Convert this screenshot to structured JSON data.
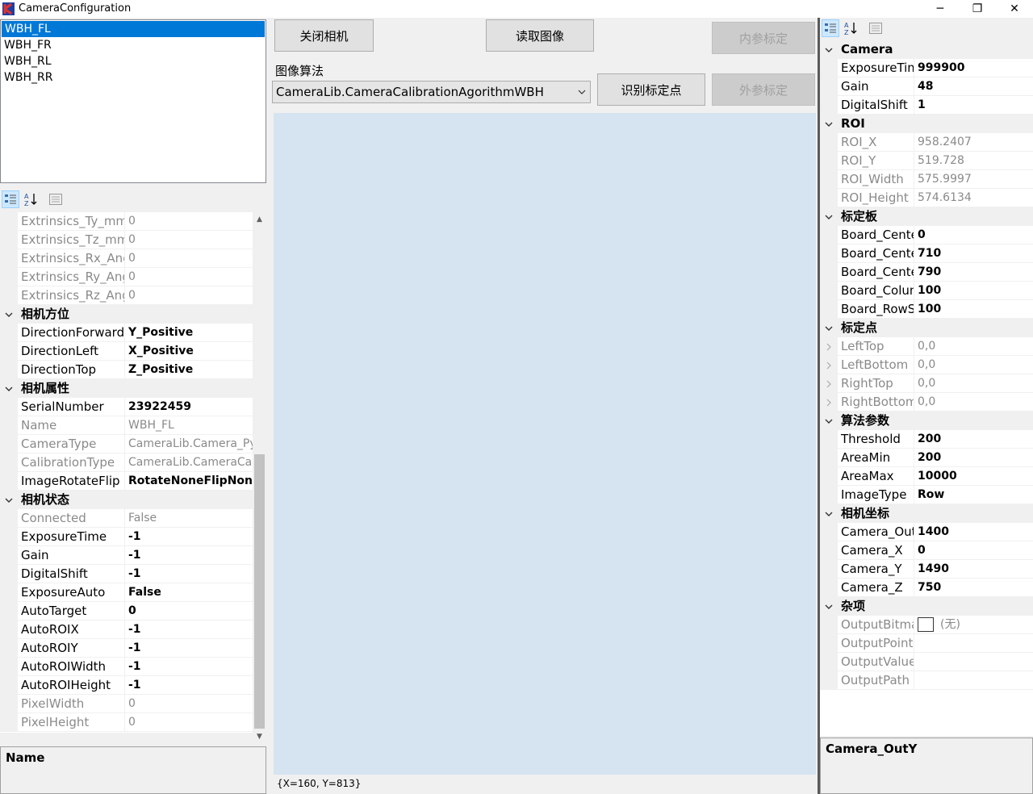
{
  "window": {
    "title": "CameraConfiguration",
    "minimize": "─",
    "restore": "❐",
    "close": "✕"
  },
  "camera_list": [
    "WBH_FL",
    "WBH_FR",
    "WBH_RL",
    "WBH_RR"
  ],
  "selected_camera": "WBH_FL",
  "buttons": {
    "close_camera": "关闭相机",
    "read_image": "读取图像",
    "intrinsic_calib": "内参标定",
    "identify_points": "识别标定点",
    "extrinsic_calib": "外参标定"
  },
  "algorithm": {
    "label": "图像算法",
    "value": "CameraLib.CameraCalibrationAgorithmWBH"
  },
  "coord_text": "{X=160, Y=813}",
  "left_grid": {
    "rows_top": [
      {
        "name": "Extrinsics_Ty_mm",
        "value": "0"
      },
      {
        "name": "Extrinsics_Tz_mm",
        "value": "0"
      },
      {
        "name": "Extrinsics_Rx_Ang",
        "value": "0"
      },
      {
        "name": "Extrinsics_Ry_Ang",
        "value": "0"
      },
      {
        "name": "Extrinsics_Rz_Ang",
        "value": "0"
      }
    ],
    "cat_direction": "相机方位",
    "direction": [
      {
        "name": "DirectionForward",
        "value": "Y_Positive"
      },
      {
        "name": "DirectionLeft",
        "value": "X_Positive"
      },
      {
        "name": "DirectionTop",
        "value": "Z_Positive"
      }
    ],
    "cat_props": "相机属性",
    "props": [
      {
        "name": "SerialNumber",
        "value": "23922459",
        "ro": false
      },
      {
        "name": "Name",
        "value": "WBH_FL",
        "ro": true
      },
      {
        "name": "CameraType",
        "value": "CameraLib.Camera_Pyl",
        "ro": true
      },
      {
        "name": "CalibrationType",
        "value": "CameraLib.CameraCali",
        "ro": true
      },
      {
        "name": "ImageRotateFlip",
        "value": "RotateNoneFlipNone",
        "ro": false
      }
    ],
    "cat_status": "相机状态",
    "status": [
      {
        "name": "Connected",
        "value": "False",
        "ro": true
      },
      {
        "name": "ExposureTime",
        "value": "-1",
        "ro": false
      },
      {
        "name": "Gain",
        "value": "-1",
        "ro": false
      },
      {
        "name": "DigitalShift",
        "value": "-1",
        "ro": false
      },
      {
        "name": "ExposureAuto",
        "value": "False",
        "ro": false
      },
      {
        "name": "AutoTarget",
        "value": "0",
        "ro": false
      },
      {
        "name": "AutoROIX",
        "value": "-1",
        "ro": false
      },
      {
        "name": "AutoROIY",
        "value": "-1",
        "ro": false
      },
      {
        "name": "AutoROIWidth",
        "value": "-1",
        "ro": false
      },
      {
        "name": "AutoROIHeight",
        "value": "-1",
        "ro": false
      },
      {
        "name": "PixelWidth",
        "value": "0",
        "ro": true
      },
      {
        "name": "PixelHeight",
        "value": "0",
        "ro": true
      }
    ],
    "description": "Name"
  },
  "right_grid": {
    "categories": [
      {
        "name": "Camera",
        "rows": [
          {
            "name": "ExposureTim",
            "value": "999900",
            "ro": false
          },
          {
            "name": "Gain",
            "value": "48",
            "ro": false
          },
          {
            "name": "DigitalShift",
            "value": "1",
            "ro": false
          }
        ]
      },
      {
        "name": "ROI",
        "rows": [
          {
            "name": "ROI_X",
            "value": "958.2407",
            "ro": true
          },
          {
            "name": "ROI_Y",
            "value": "519.728",
            "ro": true
          },
          {
            "name": "ROI_Width",
            "value": "575.9997",
            "ro": true
          },
          {
            "name": "ROI_Height",
            "value": "574.6134",
            "ro": true
          }
        ]
      },
      {
        "name": "标定板",
        "rows": [
          {
            "name": "Board_Cente",
            "value": "0",
            "ro": false
          },
          {
            "name": "Board_Cente",
            "value": "710",
            "ro": false
          },
          {
            "name": "Board_Cente",
            "value": "790",
            "ro": false
          },
          {
            "name": "Board_Colum",
            "value": "100",
            "ro": false
          },
          {
            "name": "Board_RowSp",
            "value": "100",
            "ro": false
          }
        ]
      },
      {
        "name": "标定点",
        "rows": [
          {
            "name": "LeftTop",
            "value": "0,0",
            "ro": true,
            "expand": true
          },
          {
            "name": "LeftBottom",
            "value": "0,0",
            "ro": true,
            "expand": true
          },
          {
            "name": "RightTop",
            "value": "0,0",
            "ro": true,
            "expand": true
          },
          {
            "name": "RightBottom",
            "value": "0,0",
            "ro": true,
            "expand": true
          }
        ]
      },
      {
        "name": "算法参数",
        "rows": [
          {
            "name": "Threshold",
            "value": "200",
            "ro": false
          },
          {
            "name": "AreaMin",
            "value": "200",
            "ro": false
          },
          {
            "name": "AreaMax",
            "value": "10000",
            "ro": false
          },
          {
            "name": "ImageType",
            "value": "Row",
            "ro": false
          }
        ]
      },
      {
        "name": "相机坐标",
        "rows": [
          {
            "name": "Camera_OutY",
            "value": "1400",
            "ro": false
          },
          {
            "name": "Camera_X",
            "value": "0",
            "ro": false
          },
          {
            "name": "Camera_Y",
            "value": "1490",
            "ro": false
          },
          {
            "name": "Camera_Z",
            "value": "750",
            "ro": false
          }
        ]
      },
      {
        "name": "杂项",
        "rows": [
          {
            "name": "OutputBitma",
            "value": "(无)",
            "ro": true,
            "checkbox": true
          },
          {
            "name": "OutputPoints",
            "value": "",
            "ro": true
          },
          {
            "name": "OutputValue",
            "value": "",
            "ro": true
          },
          {
            "name": "OutputPath",
            "value": "",
            "ro": true
          }
        ]
      }
    ],
    "description": "Camera_OutY"
  }
}
